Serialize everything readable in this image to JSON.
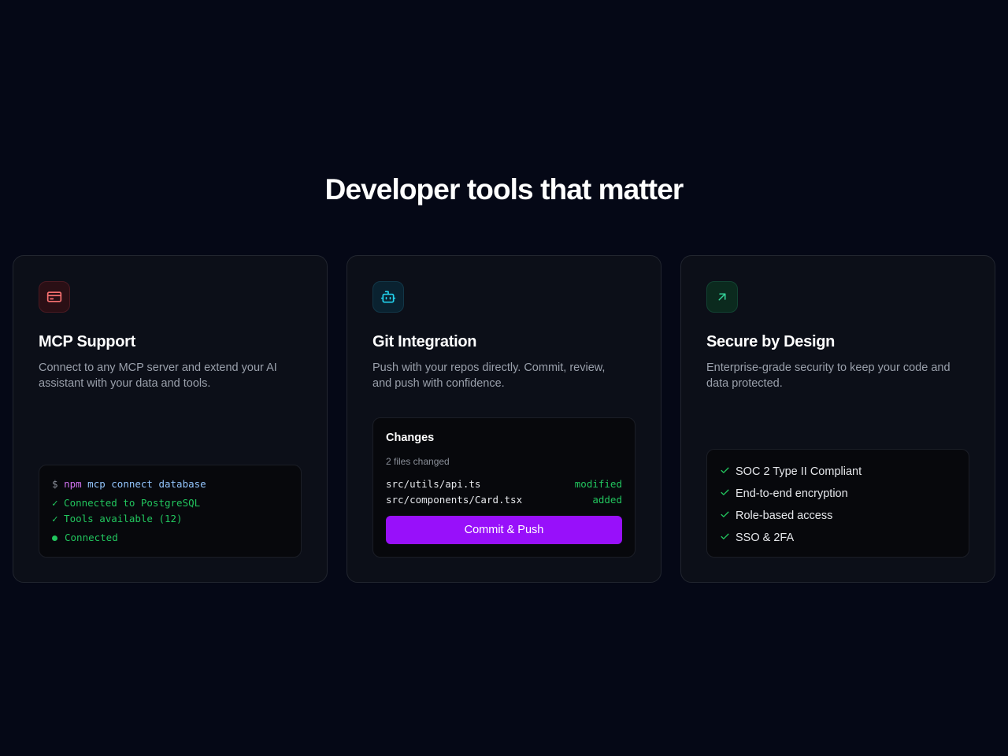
{
  "heading": "Developer tools that matter",
  "colors": {
    "background": "#050816",
    "card": "#0c0f18",
    "accent_purple": "#9810fa",
    "success_green": "#22c55e",
    "icon_red": "#f87171",
    "icon_cyan": "#22d3ee"
  },
  "cards": [
    {
      "icon": "credit-card-icon",
      "title": "MCP Support",
      "description": "Connect to any MCP server and extend your AI assistant with your data and tools.",
      "terminal": {
        "prompt": "$",
        "npm": "npm",
        "command": "mcp connect database",
        "lines": [
          "✓ Connected to PostgreSQL",
          "✓ Tools available (12)"
        ],
        "status": "Connected"
      }
    },
    {
      "icon": "bot-icon",
      "title": "Git Integration",
      "description": "Push with your repos directly. Commit, review, and push with confidence.",
      "git": {
        "title": "Changes",
        "subtitle": "2 files changed",
        "files": [
          {
            "name": "src/utils/api.ts",
            "status": "modified"
          },
          {
            "name": "src/components/Card.tsx",
            "status": "added"
          }
        ],
        "button": "Commit & Push"
      }
    },
    {
      "icon": "arrow-up-right-icon",
      "title": "Secure by Design",
      "description": "Enterprise-grade security to keep your code and data protected.",
      "features": [
        "SOC 2 Type II Compliant",
        "End-to-end encryption",
        "Role-based access",
        "SSO & 2FA"
      ]
    }
  ]
}
